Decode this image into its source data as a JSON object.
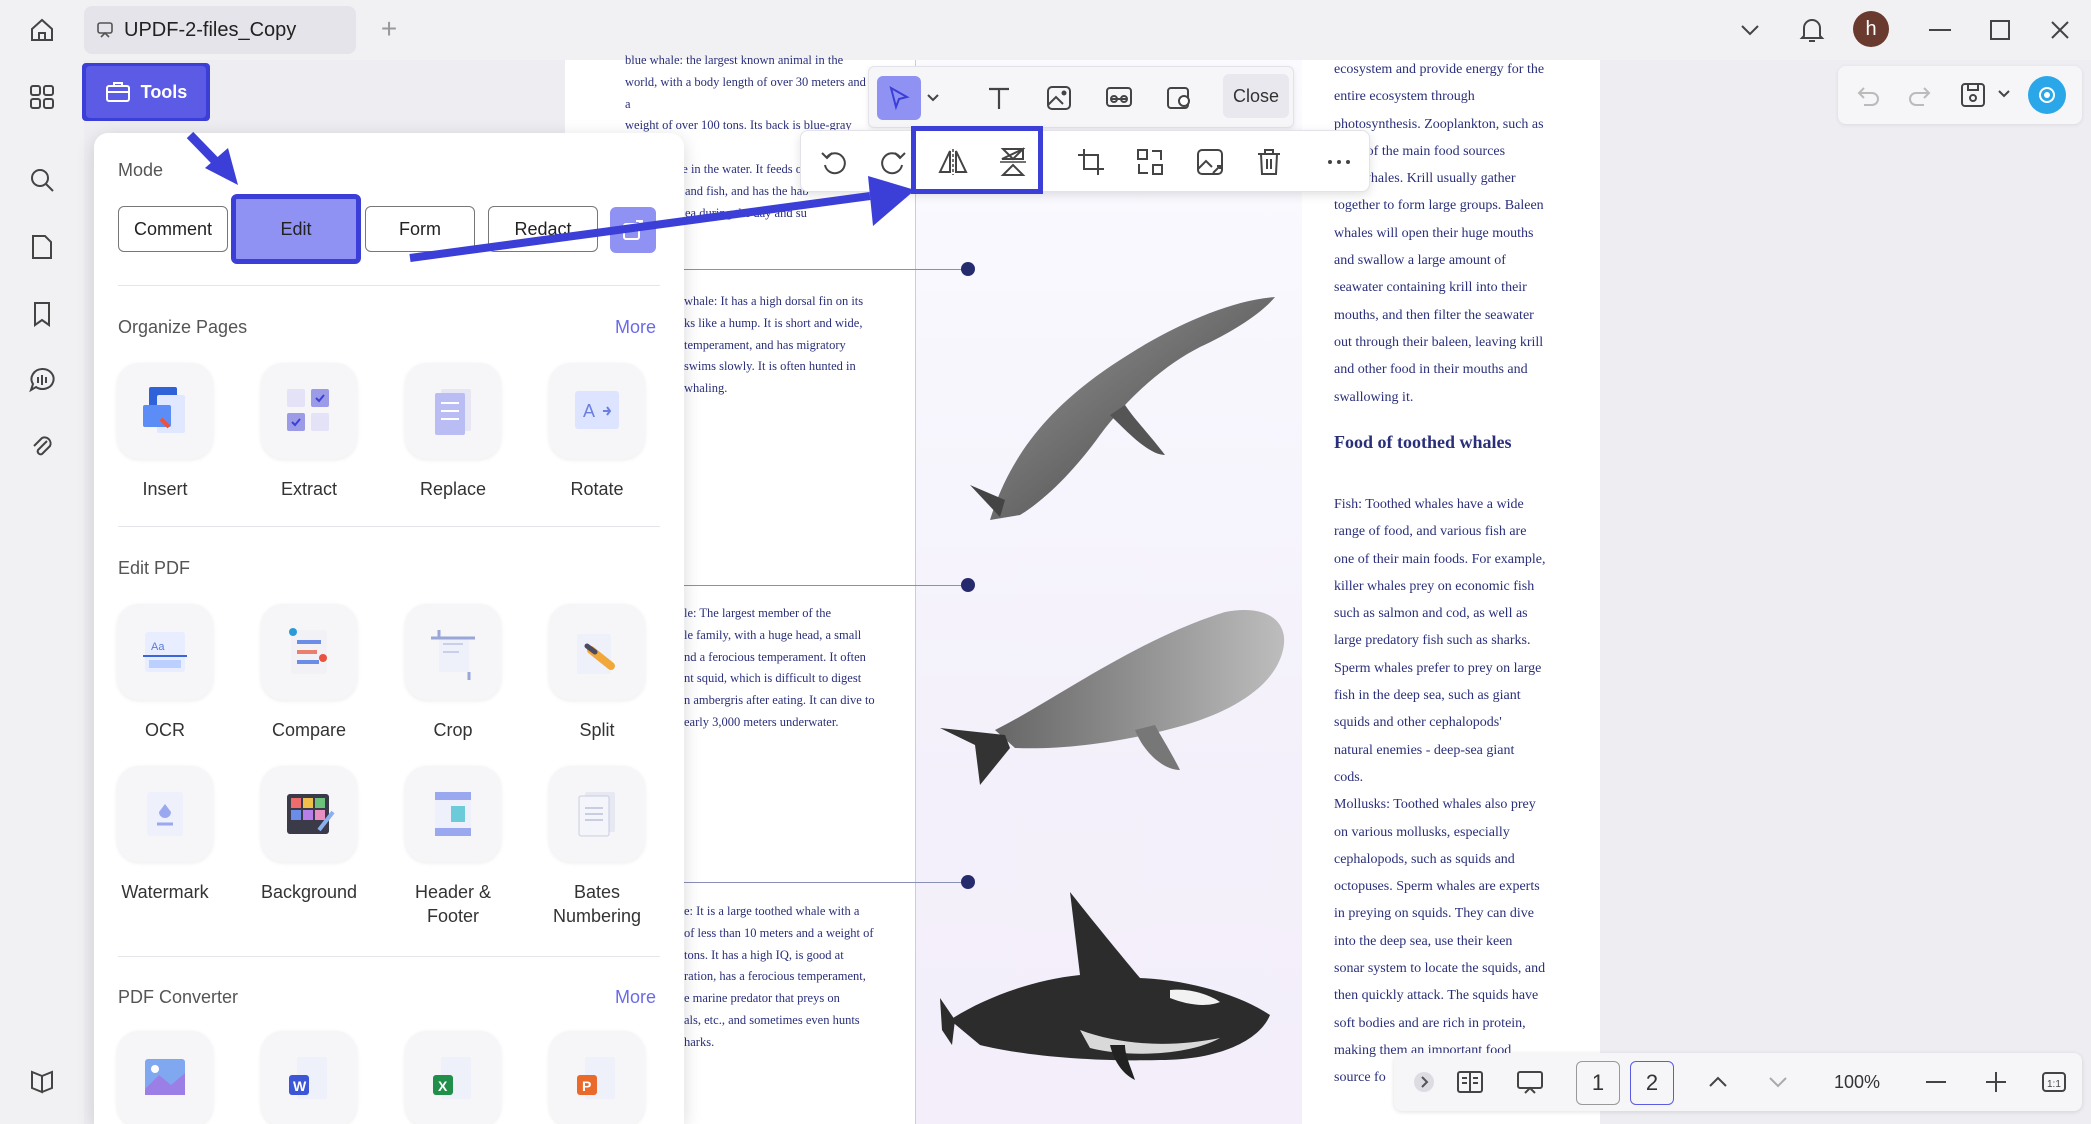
{
  "titlebar": {
    "tab_title": "UPDF-2-files_Copy",
    "avatar_letter": "h"
  },
  "edit_toolbar": {
    "close_label": "Close"
  },
  "tools_panel": {
    "tools_label": "Tools",
    "mode_label": "Mode",
    "modes": [
      "Comment",
      "Edit",
      "Form",
      "Redact"
    ],
    "organize_label": "Organize Pages",
    "organize_more": "More",
    "organize_tools": [
      "Insert",
      "Extract",
      "Replace",
      "Rotate"
    ],
    "edit_label": "Edit PDF",
    "edit_tools": [
      "OCR",
      "Compare",
      "Crop",
      "Split"
    ],
    "edit_tools_2": [
      "Watermark",
      "Background",
      "Header &\nFooter",
      "Bates\nNumbering"
    ],
    "converter_label": "PDF Converter",
    "converter_more": "More"
  },
  "document": {
    "left_blocks": [
      {
        "lines": [
          "blue whale: the largest known animal in the",
          "world, with a body length of over 30 meters and a",
          "weight of over 100 tons. Its back is blue-gray and",
          "appears blue in the water. It feeds on small",
          "and fish, and has the hab",
          "ea during the day and su"
        ]
      },
      {
        "lines": [
          "whale: It has a high dorsal fin on its",
          "ks like a hump. It is short and wide,",
          "temperament, and has migratory",
          "swims slowly. It is often hunted in",
          "whaling."
        ]
      },
      {
        "lines": [
          "le: The largest member of the",
          "le family, with a huge head, a small",
          "nd a ferocious temperament. It often",
          "nt squid, which is difficult to digest",
          "n ambergris after eating. It can dive to",
          "early 3,000 meters underwater."
        ]
      },
      {
        "lines": [
          "e: It is a large toothed whale with a",
          "of less than 10 meters and a weight of",
          "tons. It has a high IQ, is good at",
          "ration, has a ferocious temperament,",
          "e marine predator that preys on",
          "als, etc., and sometimes even hunts",
          "harks."
        ]
      }
    ],
    "right_top": "ecosystem and provide energy for the\nentire ecosystem through\nphotosynthesis. Zooplankton, such as\ns one of the main food sources\nleen whales. Krill usually gather\ntogether to form large groups. Baleen\nwhales will open their huge mouths\nand swallow a large amount of\nseawater containing krill into their\nmouths, and then filter the seawater\nout through their baleen, leaving krill\nand other food in their mouths and\nswallowing it.",
    "food_heading": "Food of toothed whales",
    "right_bottom": "Fish: Toothed whales have a wide\nrange of food, and various fish are\none of their main foods. For example,\nkiller whales prey on economic fish\nsuch as salmon and cod, as well as\nlarge predatory fish such as sharks.\nSperm whales prefer to prey on large\nfish in the deep sea, such as giant\nsquids and other cephalopods'\nnatural enemies - deep-sea giant\ncods.\nMollusks: Toothed whales also prey\non various mollusks, especially\ncephalopods, such as squids and\noctopuses. Sperm whales are experts\nin preying on squids. They can dive\ninto the deep sea, use their keen\nsonar system to locate the squids, and\nthen quickly attack. The squids have\nsoft bodies and are rich in protein,\nmaking them an important food\nsource fo"
  },
  "bottom_nav": {
    "pages": [
      "1",
      "2"
    ],
    "current_page": "2",
    "zoom": "100%"
  },
  "colors": {
    "accent": "#5b5be6",
    "highlight": "#3b3fd8",
    "doc_text": "#2a2f7a"
  },
  "icons": [
    "home-icon",
    "grid-icon",
    "search-icon",
    "pages-icon",
    "bookmark-icon",
    "ai-chat-icon",
    "attachment-icon",
    "layers-icon",
    "bell-icon",
    "chevron-down-icon",
    "minimize-icon",
    "maximize-icon",
    "close-icon",
    "undo-icon",
    "redo-icon",
    "save-icon",
    "updf-ai-icon"
  ]
}
